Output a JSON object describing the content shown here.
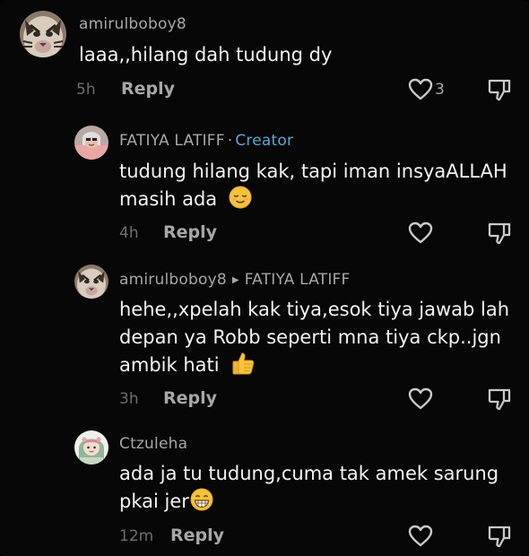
{
  "comments": [
    {
      "username": "amirulboboy8",
      "text_lines": [
        "laaa,,hilang dah tudung dy"
      ],
      "time": "5h",
      "reply_label": "Reply",
      "like_count": "3",
      "avatar_icon": "tiger-avatar"
    },
    {
      "username": "FATIYA LATIFF",
      "separator": "·",
      "creator_badge": "Creator",
      "text_lines": [
        "tudung hilang kak, tapi iman insyaALLAH",
        "masih ada"
      ],
      "emoji": "relieved-face-emoji",
      "time": "4h",
      "reply_label": "Reply",
      "avatar_icon": "user-photo-avatar"
    },
    {
      "username": "amirulboboy8",
      "reply_to": "FATIYA LATIFF",
      "text_lines": [
        "hehe,,xpelah kak tiya,esok tiya jawab lah",
        "depan ya Robb seperti mna tiya ckp..jgn",
        "ambik hati"
      ],
      "emoji": "thumbs-up-emoji",
      "time": "3h",
      "reply_label": "Reply",
      "avatar_icon": "tiger-avatar"
    },
    {
      "username": "Ctzuleha",
      "text_lines": [
        "ada ja tu tudung,cuma tak amek sarung",
        "pkai jer"
      ],
      "emoji": "grinning-face-emoji",
      "time": "12m",
      "reply_label": "Reply",
      "avatar_icon": "cartoon-girl-avatar"
    }
  ],
  "colors": {
    "background": "#070707",
    "text": "#f4f4f4",
    "username": "#a7a7a7",
    "creator": "#59a8d8",
    "time": "#6e6e6e"
  },
  "icons": {
    "like": "heart-outline-icon",
    "dislike": "thumbs-down-outline-icon"
  }
}
